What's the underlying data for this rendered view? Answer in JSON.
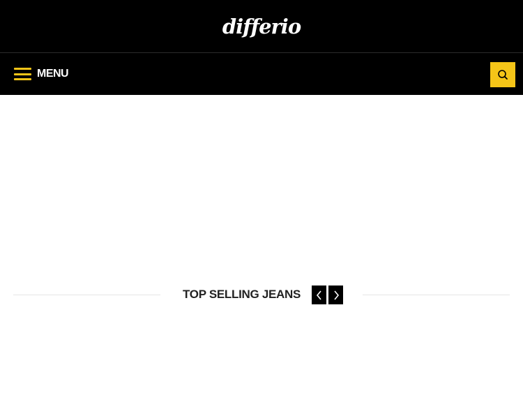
{
  "header": {
    "logo_text": "differio"
  },
  "nav": {
    "menu_label": "MENU",
    "menu_icon": "hamburger-icon",
    "search_icon": "search-icon",
    "accent_color": "#f5c518"
  },
  "section": {
    "title": "TOP SELLING JEANS",
    "prev_icon": "chevron-left-icon",
    "next_icon": "chevron-right-icon"
  }
}
